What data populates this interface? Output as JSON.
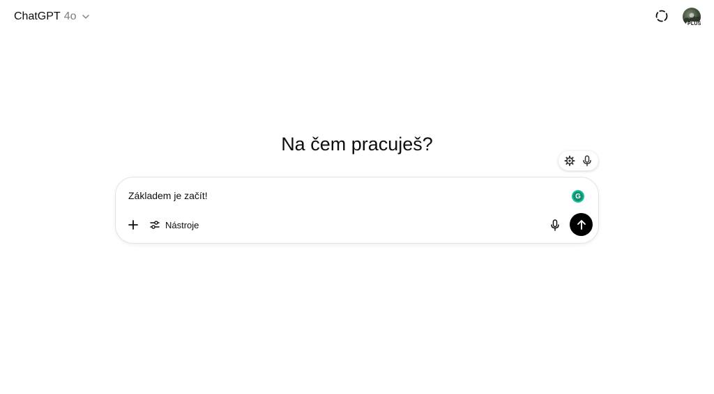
{
  "header": {
    "app_name": "ChatGPT",
    "model_version": "4o",
    "model_dropdown_icon": "chevron-down-icon",
    "temporary_chat_icon": "dashed-circle-icon",
    "plan_badge": "PLUS"
  },
  "main": {
    "headline": "Na čem pracuješ?"
  },
  "voice_pill": {
    "icons": [
      "gear-icon",
      "microphone-icon"
    ]
  },
  "composer": {
    "input_text": "Základem je začít!",
    "grammarly_letter": "G",
    "tools_label": "Nástroje",
    "add_icon": "plus-icon",
    "tools_icon": "sliders-icon",
    "dictate_icon": "microphone-icon",
    "send_icon": "arrow-up-icon"
  },
  "colors": {
    "send_button": "#000000",
    "grammarly": "#15c39a",
    "muted_text": "#7d7d7d"
  }
}
